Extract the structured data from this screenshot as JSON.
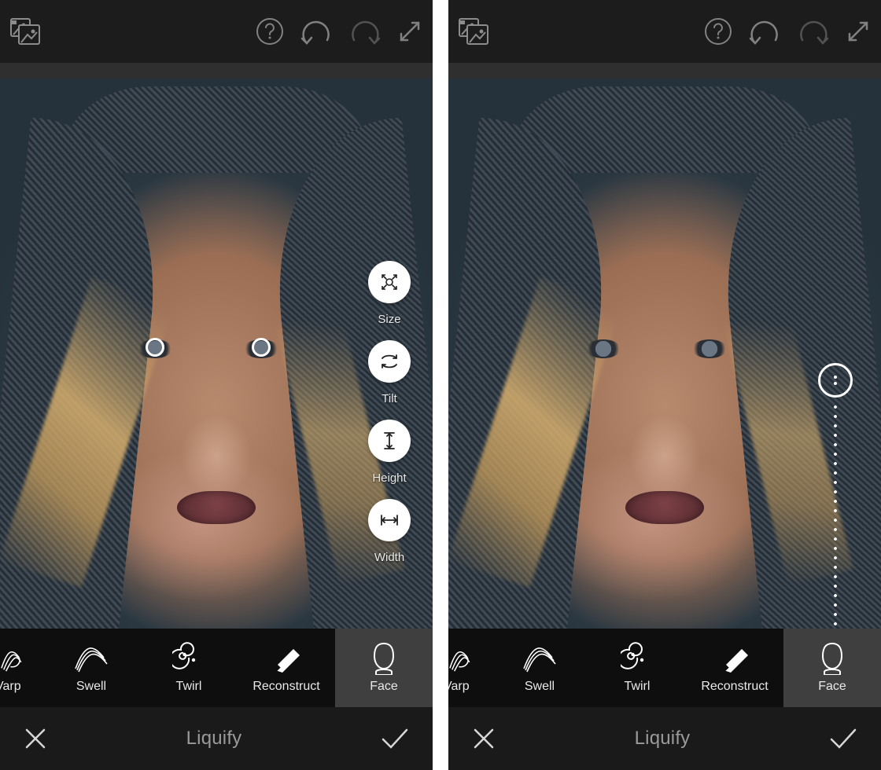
{
  "header": {
    "icons": {
      "compare": "compare-icon",
      "help": "help-icon",
      "undo": "undo-icon",
      "redo": "redo-icon",
      "fullscreen": "fullscreen-icon"
    }
  },
  "faceControls": [
    {
      "id": "size",
      "label": "Size",
      "icon": "size-icon"
    },
    {
      "id": "tilt",
      "label": "Tilt",
      "icon": "tilt-icon"
    },
    {
      "id": "height",
      "label": "Height",
      "icon": "height-icon"
    },
    {
      "id": "width",
      "label": "Width",
      "icon": "width-icon"
    }
  ],
  "tools": [
    {
      "id": "warp",
      "label": "Warp",
      "icon": "warp-icon"
    },
    {
      "id": "swell",
      "label": "Swell",
      "icon": "swell-icon"
    },
    {
      "id": "twirl",
      "label": "Twirl",
      "icon": "twirl-icon"
    },
    {
      "id": "reconstruct",
      "label": "Reconstruct",
      "icon": "reconstruct-icon"
    },
    {
      "id": "face",
      "label": "Face",
      "icon": "face-icon",
      "selected": true
    }
  ],
  "tools_trunc_first_label": "Varp",
  "bottom": {
    "cancel": "cancel-icon",
    "title": "Liquify",
    "confirm": "confirm-icon"
  },
  "colors": {
    "header": "#1c1c1c",
    "band": "#2f2f2f",
    "toolbar": "#0e0e0e",
    "selected": "#3f3f3f",
    "bottom": "#1a1a1a",
    "label": "#9a9a9a",
    "white": "#ffffff"
  }
}
